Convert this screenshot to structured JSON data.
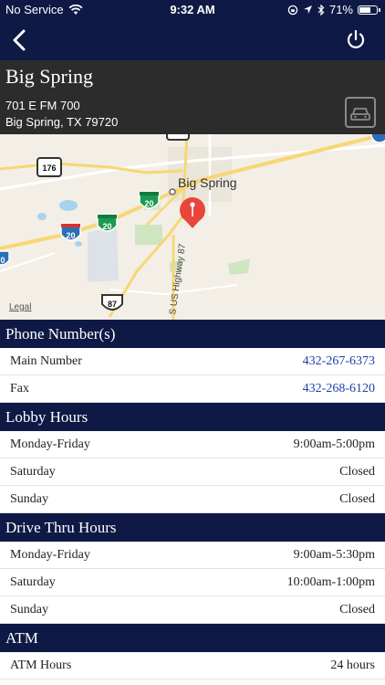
{
  "status_bar": {
    "carrier": "No Service",
    "time": "9:32 AM",
    "battery": "71%",
    "battery_level": 0.71
  },
  "nav": {
    "back_icon": "chevron-left-icon",
    "power_icon": "power-icon"
  },
  "branch": {
    "name": "Big Spring",
    "address_line1": "701 E FM 700",
    "address_line2": "Big Spring, TX 79720",
    "directions_icon": "car-icon"
  },
  "map": {
    "city_label": "Big Spring",
    "highway_label": "S US Highway 87",
    "shields": {
      "route_176": "176",
      "i20_left": "20",
      "i20_mid": "20",
      "i20_top": "20",
      "us87": "87",
      "edge_left": "0"
    },
    "legal": "Legal",
    "pin_color": "#e8453c"
  },
  "sections": {
    "phone": {
      "title": "Phone Number(s)",
      "rows": [
        {
          "label": "Main Number",
          "value": "432-267-6373"
        },
        {
          "label": "Fax",
          "value": "432-268-6120"
        }
      ]
    },
    "lobby": {
      "title": "Lobby Hours",
      "rows": [
        {
          "label": "Monday-Friday",
          "value": "9:00am-5:00pm"
        },
        {
          "label": "Saturday",
          "value": "Closed"
        },
        {
          "label": "Sunday",
          "value": "Closed"
        }
      ]
    },
    "drive": {
      "title": "Drive Thru Hours",
      "rows": [
        {
          "label": "Monday-Friday",
          "value": "9:00am-5:30pm"
        },
        {
          "label": "Saturday",
          "value": "10:00am-1:00pm"
        },
        {
          "label": "Sunday",
          "value": "Closed"
        }
      ]
    },
    "atm": {
      "title": "ATM",
      "rows": [
        {
          "label": "ATM Hours",
          "value": "24 hours"
        }
      ]
    }
  },
  "colors": {
    "nav_background": "#0e1a45",
    "branch_background": "#2c2c2c",
    "link": "#1f3fa8"
  }
}
